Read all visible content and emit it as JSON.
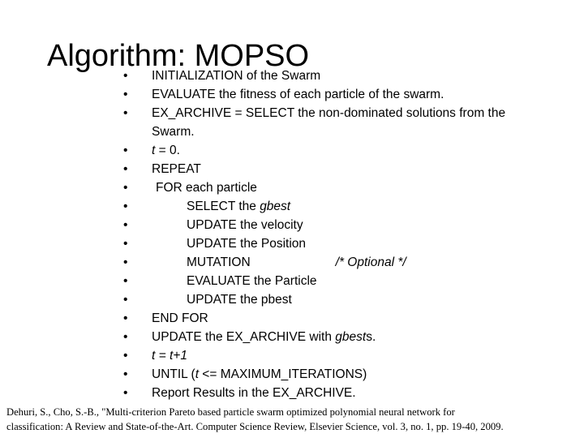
{
  "slide": {
    "title": "Algorithm: MOPSO",
    "background_color": "#ffffff",
    "text_color": "#000000"
  },
  "bullet_glyph": "•",
  "algorithm_steps": [
    {
      "indent": 0,
      "text": "INITIALIZATION of the Swarm"
    },
    {
      "indent": 0,
      "text": "EVALUATE the fitness of each particle of the swarm."
    },
    {
      "indent": 0,
      "text": "EX_ARCHIVE = SELECT the non-dominated solutions from the Swarm."
    },
    {
      "indent": 0,
      "text": "t = 0.",
      "italic_prefix": "t",
      "rest": " = 0."
    },
    {
      "indent": 0,
      "text": "REPEAT"
    },
    {
      "indent": 1,
      "text": "FOR each particle"
    },
    {
      "indent": 2,
      "text": "SELECT the gbest",
      "plain": "SELECT the ",
      "italic_tail": "gbest"
    },
    {
      "indent": 2,
      "text": "UPDATE the velocity"
    },
    {
      "indent": 2,
      "text": "UPDATE the Position"
    },
    {
      "indent": 2,
      "text": "MUTATION",
      "comment": "/*  Optional  */"
    },
    {
      "indent": 2,
      "text": "EVALUATE the Particle"
    },
    {
      "indent": 2,
      "text": "UPDATE the pbest"
    },
    {
      "indent": 0,
      "text": "END FOR"
    },
    {
      "indent": 0,
      "text": "UPDATE the EX_ARCHIVE with gbests.",
      "plain": "UPDATE the EX_ARCHIVE with ",
      "italic_tail": "gbest",
      "after": "s."
    },
    {
      "indent": 0,
      "text": "t = t+1",
      "italic_whole": "t = t+1"
    },
    {
      "indent": 0,
      "text": "UNTIL (t <= MAXIMUM_ITERATIONS)",
      "plain": "UNTIL (",
      "italic_tail": "t",
      "after": " <= MAXIMUM_ITERATIONS)"
    },
    {
      "indent": 0,
      "text": "Report Results in the EX_ARCHIVE."
    }
  ],
  "citation": {
    "line1": "Dehuri, S., Cho, S.-B., \"Multi-criterion Pareto based particle swarm optimized polynomial neural network for",
    "line2": "classification: A Review and State-of-the-Art. Computer Science Review, Elsevier Science, vol. 3, no. 1, pp. 19-40, 2009."
  }
}
